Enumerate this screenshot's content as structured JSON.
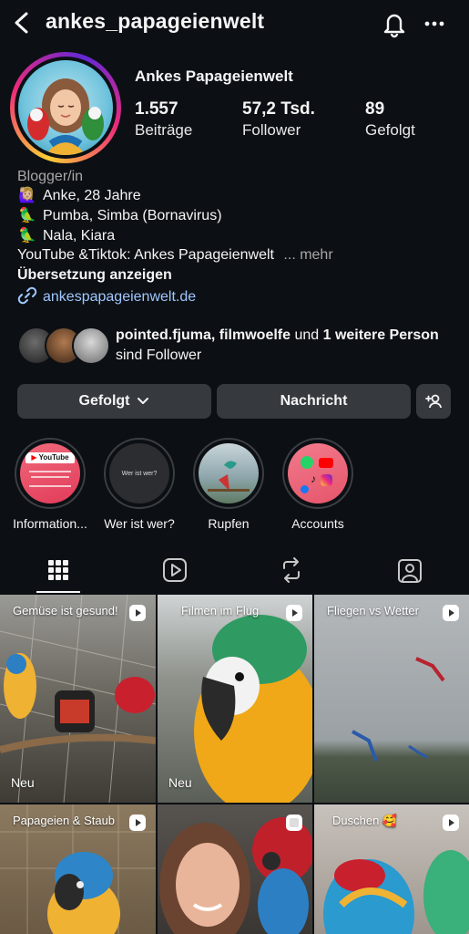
{
  "header": {
    "username": "ankes_papageienwelt"
  },
  "profile": {
    "full_name": "Ankes Papageienwelt",
    "stats": [
      {
        "value": "1.557",
        "label": "Beiträge"
      },
      {
        "value": "57,2 Tsd.",
        "label": "Follower"
      },
      {
        "value": "89",
        "label": "Gefolgt"
      }
    ],
    "category": "Blogger/in",
    "bio_lines": [
      {
        "emoji": "🙋🏼‍♀️",
        "text": "Anke, 28 Jahre"
      },
      {
        "emoji": "🦜",
        "text": "Pumba, Simba (Bornavirus)"
      },
      {
        "emoji": "🦜",
        "text": "Nala, Kiara"
      }
    ],
    "bio_last": "YouTube &Tiktok: Ankes Papageienwelt",
    "more_label": "... mehr",
    "translate_label": "Übersetzung anzeigen",
    "link_text": "ankespapageienwelt.de"
  },
  "mutual": {
    "name1": "pointed.fjuma",
    "sep1": ", ",
    "name2": "filmwoelfe",
    "and_text": " und ",
    "others": "1 weitere Person",
    "tail": " sind Follower"
  },
  "actions": {
    "following_label": "Gefolgt",
    "message_label": "Nachricht"
  },
  "highlights": [
    {
      "label": "Information...",
      "cover_text": "YouTube"
    },
    {
      "label": "Wer ist wer?",
      "cover_text": "Wer ist wer?"
    },
    {
      "label": "Rupfen",
      "cover_text": ""
    },
    {
      "label": "Accounts",
      "cover_text": ""
    }
  ],
  "grid": [
    {
      "title": "Gemüse ist gesund!",
      "badge": "Neu"
    },
    {
      "title": "Filmen im Flug",
      "badge": "Neu"
    },
    {
      "title": "Fliegen vs Wetter",
      "badge": ""
    },
    {
      "title": "Papageien & Staub",
      "badge": ""
    },
    {
      "title": "",
      "badge": ""
    },
    {
      "title": "Duschen 🥰",
      "badge": ""
    }
  ],
  "colors": {
    "background": "#0c1014",
    "button": "#363a3f",
    "link": "#a0c7ff",
    "muted": "#a8a8a8"
  }
}
